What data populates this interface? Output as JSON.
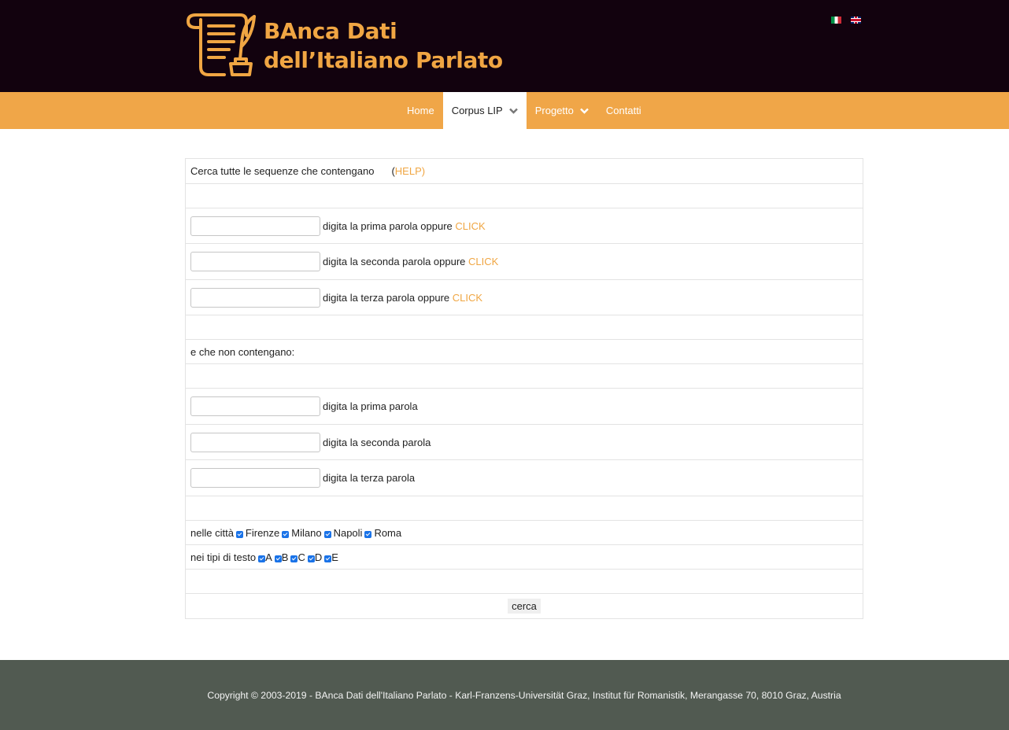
{
  "header": {
    "logo_line1": "BAnca Dati",
    "logo_line2": "dell’Italiano Parlato",
    "flags": [
      {
        "icon": "italian-flag-icon"
      },
      {
        "icon": "english-flag-icon"
      }
    ]
  },
  "nav": {
    "items": [
      {
        "label": "Home"
      },
      {
        "label": "Corpus LIP"
      },
      {
        "label": "Progetto"
      },
      {
        "label": "Contatti"
      }
    ]
  },
  "form": {
    "intro": "Cerca tutte le sequenze che contengano",
    "help_open": "(",
    "help_label": "HELP)",
    "include_rows": [
      {
        "label": "digita la prima parola oppure",
        "link": "CLICK",
        "value": ""
      },
      {
        "label": "digita la seconda parola oppure",
        "link": "CLICK",
        "value": ""
      },
      {
        "label": "digita la terza parola oppure",
        "link": "CLICK",
        "value": ""
      }
    ],
    "exclude_title": "e che non contengano:",
    "exclude_rows": [
      {
        "label": "digita la prima parola",
        "value": ""
      },
      {
        "label": "digita la seconda parola",
        "value": ""
      },
      {
        "label": "digita la terza parola",
        "value": ""
      }
    ],
    "cities_label": "nelle città",
    "cities": [
      {
        "label": "Firenze",
        "checked": true
      },
      {
        "label": "Milano",
        "checked": true
      },
      {
        "label": "Napoli",
        "checked": true
      },
      {
        "label": "Roma",
        "checked": true
      }
    ],
    "types_label": "nei tipi di testo",
    "types": [
      {
        "label": "A",
        "checked": true
      },
      {
        "label": "B",
        "checked": true
      },
      {
        "label": "C",
        "checked": true
      },
      {
        "label": "D",
        "checked": true
      },
      {
        "label": "E",
        "checked": true
      }
    ],
    "submit_label": "cerca"
  },
  "footer": {
    "copyright": "Copyright © 2003-2019 - BAnca Dati dell'Italiano Parlato - Karl-Franzens-Universität Graz, Institut für Romanistik, Merangasse 70, 8010 Graz, Austria"
  },
  "colors": {
    "header_bg": "#12020e",
    "accent": "#f0a648",
    "footer_bg": "#515a51",
    "checkbox": "#1a73e8"
  }
}
